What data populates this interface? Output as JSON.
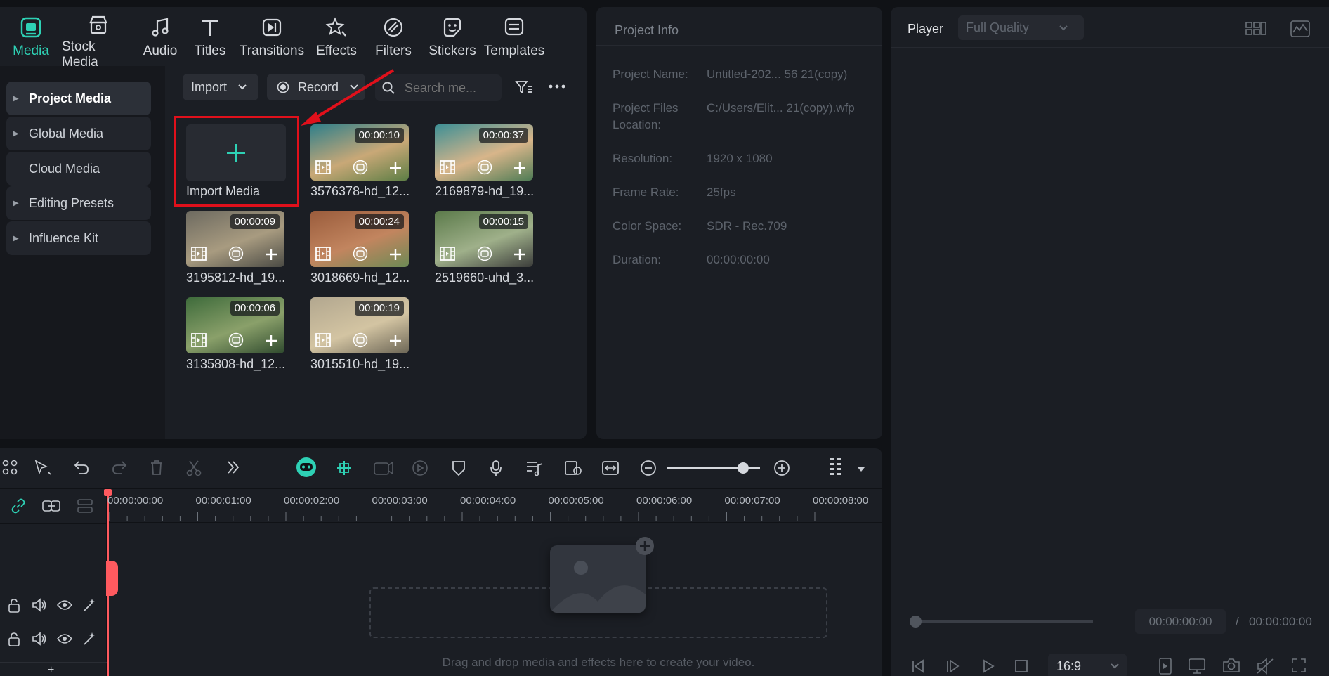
{
  "tabs": [
    {
      "label": "Media",
      "icon": "media-icon",
      "active": true
    },
    {
      "label": "Stock Media",
      "icon": "stock-media-icon"
    },
    {
      "label": "Audio",
      "icon": "audio-note-icon"
    },
    {
      "label": "Titles",
      "icon": "titles-t-icon"
    },
    {
      "label": "Transitions",
      "icon": "transitions-icon"
    },
    {
      "label": "Effects",
      "icon": "effects-icon"
    },
    {
      "label": "Filters",
      "icon": "filters-icon"
    },
    {
      "label": "Stickers",
      "icon": "stickers-icon"
    },
    {
      "label": "Templates",
      "icon": "templates-icon"
    }
  ],
  "sidebar": {
    "items": [
      {
        "label": "Project Media",
        "caret": true,
        "active": true
      },
      {
        "label": "Global Media",
        "caret": true
      },
      {
        "label": "Cloud Media",
        "caret": false
      },
      {
        "label": "Editing Presets",
        "caret": true
      },
      {
        "label": "Influence Kit",
        "caret": true
      }
    ]
  },
  "toolbar": {
    "import_label": "Import",
    "record_label": "Record",
    "search_placeholder": "Search me..."
  },
  "media": {
    "import_label": "Import Media",
    "items": [
      {
        "name": "3576378-hd_12...",
        "duration": "00:00:10",
        "colors": [
          "#2f7f8a",
          "#c9a877",
          "#5d7e45"
        ]
      },
      {
        "name": "2169879-hd_19...",
        "duration": "00:00:37",
        "colors": [
          "#3d8f95",
          "#d8b58a",
          "#4f7c55"
        ]
      },
      {
        "name": "3195812-hd_19...",
        "duration": "00:00:09",
        "colors": [
          "#6d6a60",
          "#a89b80",
          "#4a4a44"
        ]
      },
      {
        "name": "3018669-hd_12...",
        "duration": "00:00:24",
        "colors": [
          "#9a5c3c",
          "#c2855f",
          "#6d8a55"
        ]
      },
      {
        "name": "2519660-uhd_3...",
        "duration": "00:00:15",
        "colors": [
          "#5b7a4a",
          "#9fb08a",
          "#3b3c3a"
        ]
      },
      {
        "name": "3135808-hd_12...",
        "duration": "00:00:06",
        "colors": [
          "#3e6b3b",
          "#8aa06a",
          "#2f4a2e"
        ]
      },
      {
        "name": "3015510-hd_19...",
        "duration": "00:00:19",
        "colors": [
          "#b2a78f",
          "#d3c4a2",
          "#6c6656"
        ]
      }
    ]
  },
  "project_info": {
    "title": "Project Info",
    "rows": [
      {
        "label": "Project Name:",
        "value": "Untitled-202... 56 21(copy)"
      },
      {
        "label": "Project Files Location:",
        "value": "C:/Users/Elit... 21(copy).wfp"
      },
      {
        "label": "Resolution:",
        "value": "1920 x 1080"
      },
      {
        "label": "Frame Rate:",
        "value": "25fps"
      },
      {
        "label": "Color Space:",
        "value": "SDR - Rec.709"
      },
      {
        "label": "Duration:",
        "value": "00:00:00:00"
      }
    ]
  },
  "player": {
    "label": "Player",
    "quality": "Full Quality",
    "current_time": "00:00:00:00",
    "separator": "/",
    "total_time": "00:00:00:00",
    "aspect_ratio": "16:9"
  },
  "timeline": {
    "ruler": [
      "00:00:00:00",
      "00:00:01:00",
      "00:00:02:00",
      "00:00:03:00",
      "00:00:04:00",
      "00:00:05:00",
      "00:00:06:00",
      "00:00:07:00",
      "00:00:08:00"
    ],
    "drop_hint": "Drag and drop media and effects here to create your video.",
    "add_track": "+",
    "zoom_level": 0.82
  },
  "colors": {
    "accent": "#2ed1b5",
    "highlight": "#e0101b",
    "playhead": "#ff5a5f"
  }
}
